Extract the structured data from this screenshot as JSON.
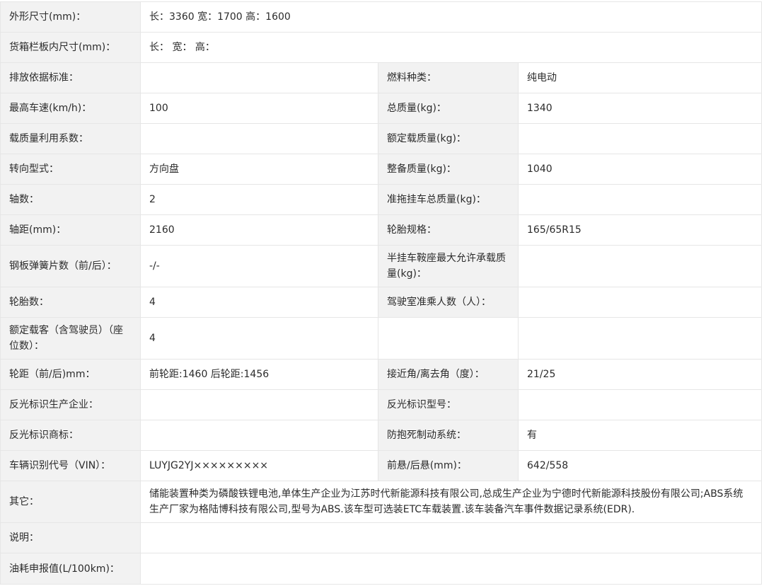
{
  "rows": [
    {
      "type": "wide",
      "label": "外形尺寸(mm)：",
      "value": "长：3360 宽：1700 高：1600"
    },
    {
      "type": "wide",
      "label": "货箱栏板内尺寸(mm)：",
      "value": "长： 宽： 高："
    },
    {
      "type": "pair",
      "label1": "排放依据标准：",
      "value1": "",
      "label2": "燃料种类：",
      "value2": "纯电动"
    },
    {
      "type": "pair",
      "label1": "最高车速(km/h)：",
      "value1": "100",
      "label2": "总质量(kg)：",
      "value2": "1340"
    },
    {
      "type": "pair",
      "label1": "载质量利用系数：",
      "value1": "",
      "label2": "额定载质量(kg)：",
      "value2": ""
    },
    {
      "type": "pair",
      "label1": "转向型式：",
      "value1": "方向盘",
      "label2": "整备质量(kg)：",
      "value2": "1040"
    },
    {
      "type": "pair",
      "label1": "轴数：",
      "value1": "2",
      "label2": "准拖挂车总质量(kg)：",
      "value2": ""
    },
    {
      "type": "pair",
      "label1": "轴距(mm)：",
      "value1": "2160",
      "label2": "轮胎规格：",
      "value2": "165/65R15"
    },
    {
      "type": "pair",
      "label1": "钢板弹簧片数（前/后）：",
      "value1": "-/-",
      "label2": "半挂车鞍座最大允许承载质量(kg)：",
      "value2": ""
    },
    {
      "type": "pair",
      "label1": "轮胎数：",
      "value1": "4",
      "label2": "驾驶室准乘人数（人）：",
      "value2": ""
    },
    {
      "type": "pair",
      "label1": "额定载客（含驾驶员）（座位数）：",
      "value1": "4",
      "label2": "",
      "value2": ""
    },
    {
      "type": "pair",
      "label1": "轮距（前/后)mm：",
      "value1": "前轮距:1460 后轮距:1456",
      "label2": "接近角/离去角（度）：",
      "value2": "21/25"
    },
    {
      "type": "pair",
      "label1": "反光标识生产企业：",
      "value1": "",
      "label2": "反光标识型号：",
      "value2": ""
    },
    {
      "type": "pair",
      "label1": "反光标识商标：",
      "value1": "",
      "label2": "防抱死制动系统：",
      "value2": "有"
    },
    {
      "type": "pair",
      "label1": "车辆识别代号（VIN）：",
      "value1": "LUYJG2YJ×××××××××",
      "label2": "前悬/后悬(mm)：",
      "value2": "642/558"
    },
    {
      "type": "wide",
      "label": "其它：",
      "value": "储能装置种类为磷酸铁锂电池,单体生产企业为江苏时代新能源科技有限公司,总成生产企业为宁德时代新能源科技股份有限公司;ABS系统生产厂家为格陆博科技有限公司,型号为ABS.该车型可选装ETC车载装置.该车装备汽车事件数据记录系统(EDR)."
    },
    {
      "type": "wide",
      "label": "说明：",
      "value": ""
    },
    {
      "type": "wide",
      "label": "油耗申报值(L/100km)：",
      "value": ""
    }
  ]
}
